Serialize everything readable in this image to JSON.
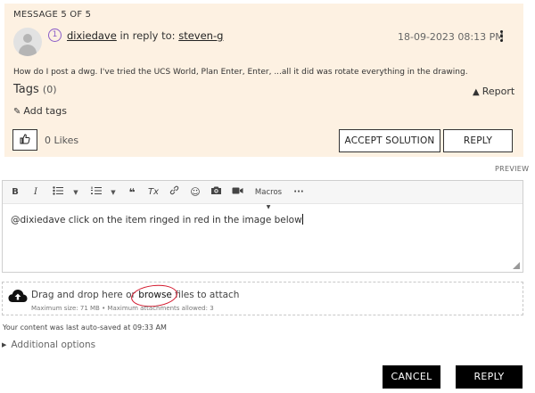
{
  "message": {
    "counter": "MESSAGE 5 OF 5",
    "rank_badge": "1",
    "author": "dixiedave",
    "reply_prefix": "in reply to:",
    "reply_to": "steven-g",
    "date": "18-09-2023 08:13 PM",
    "body": "How do I post a dwg. I've tried the UCS World, Plan Enter, Enter, ...all it did was rotate everything in the drawing.",
    "tags_label": "Tags",
    "tags_count": "(0)",
    "report_label": "Report",
    "add_tags_label": "Add tags",
    "likes_label": "0 Likes",
    "accept_label": "ACCEPT SOLUTION",
    "reply_label": "REPLY",
    "icons": [
      "user-avatar-icon",
      "rank-badge-icon",
      "more-options-icon",
      "warning-icon",
      "pencil-icon",
      "thumbs-up-icon"
    ]
  },
  "preview_label": "PREVIEW",
  "editor": {
    "toolbar": {
      "bold": "B",
      "italic": "I",
      "macros": "Macros"
    },
    "content": "@dixiedave click on the item ringed in red in the image below"
  },
  "attach": {
    "text_before": "Drag and drop here or",
    "browse": "browse",
    "text_after": "files to attach",
    "meta": "Maximum size: 71 MB • Maximum attachments allowed: 3",
    "highlight_color": "#d3162b"
  },
  "autosave": "Your content was last auto-saved at 09:33 AM",
  "additional_options": "Additional options",
  "actions": {
    "cancel": "CANCEL",
    "reply": "REPLY"
  },
  "colors": {
    "message_bg": "#fdf1e2",
    "button_dark": "#000000",
    "rank_purple": "#8a5cc8"
  }
}
